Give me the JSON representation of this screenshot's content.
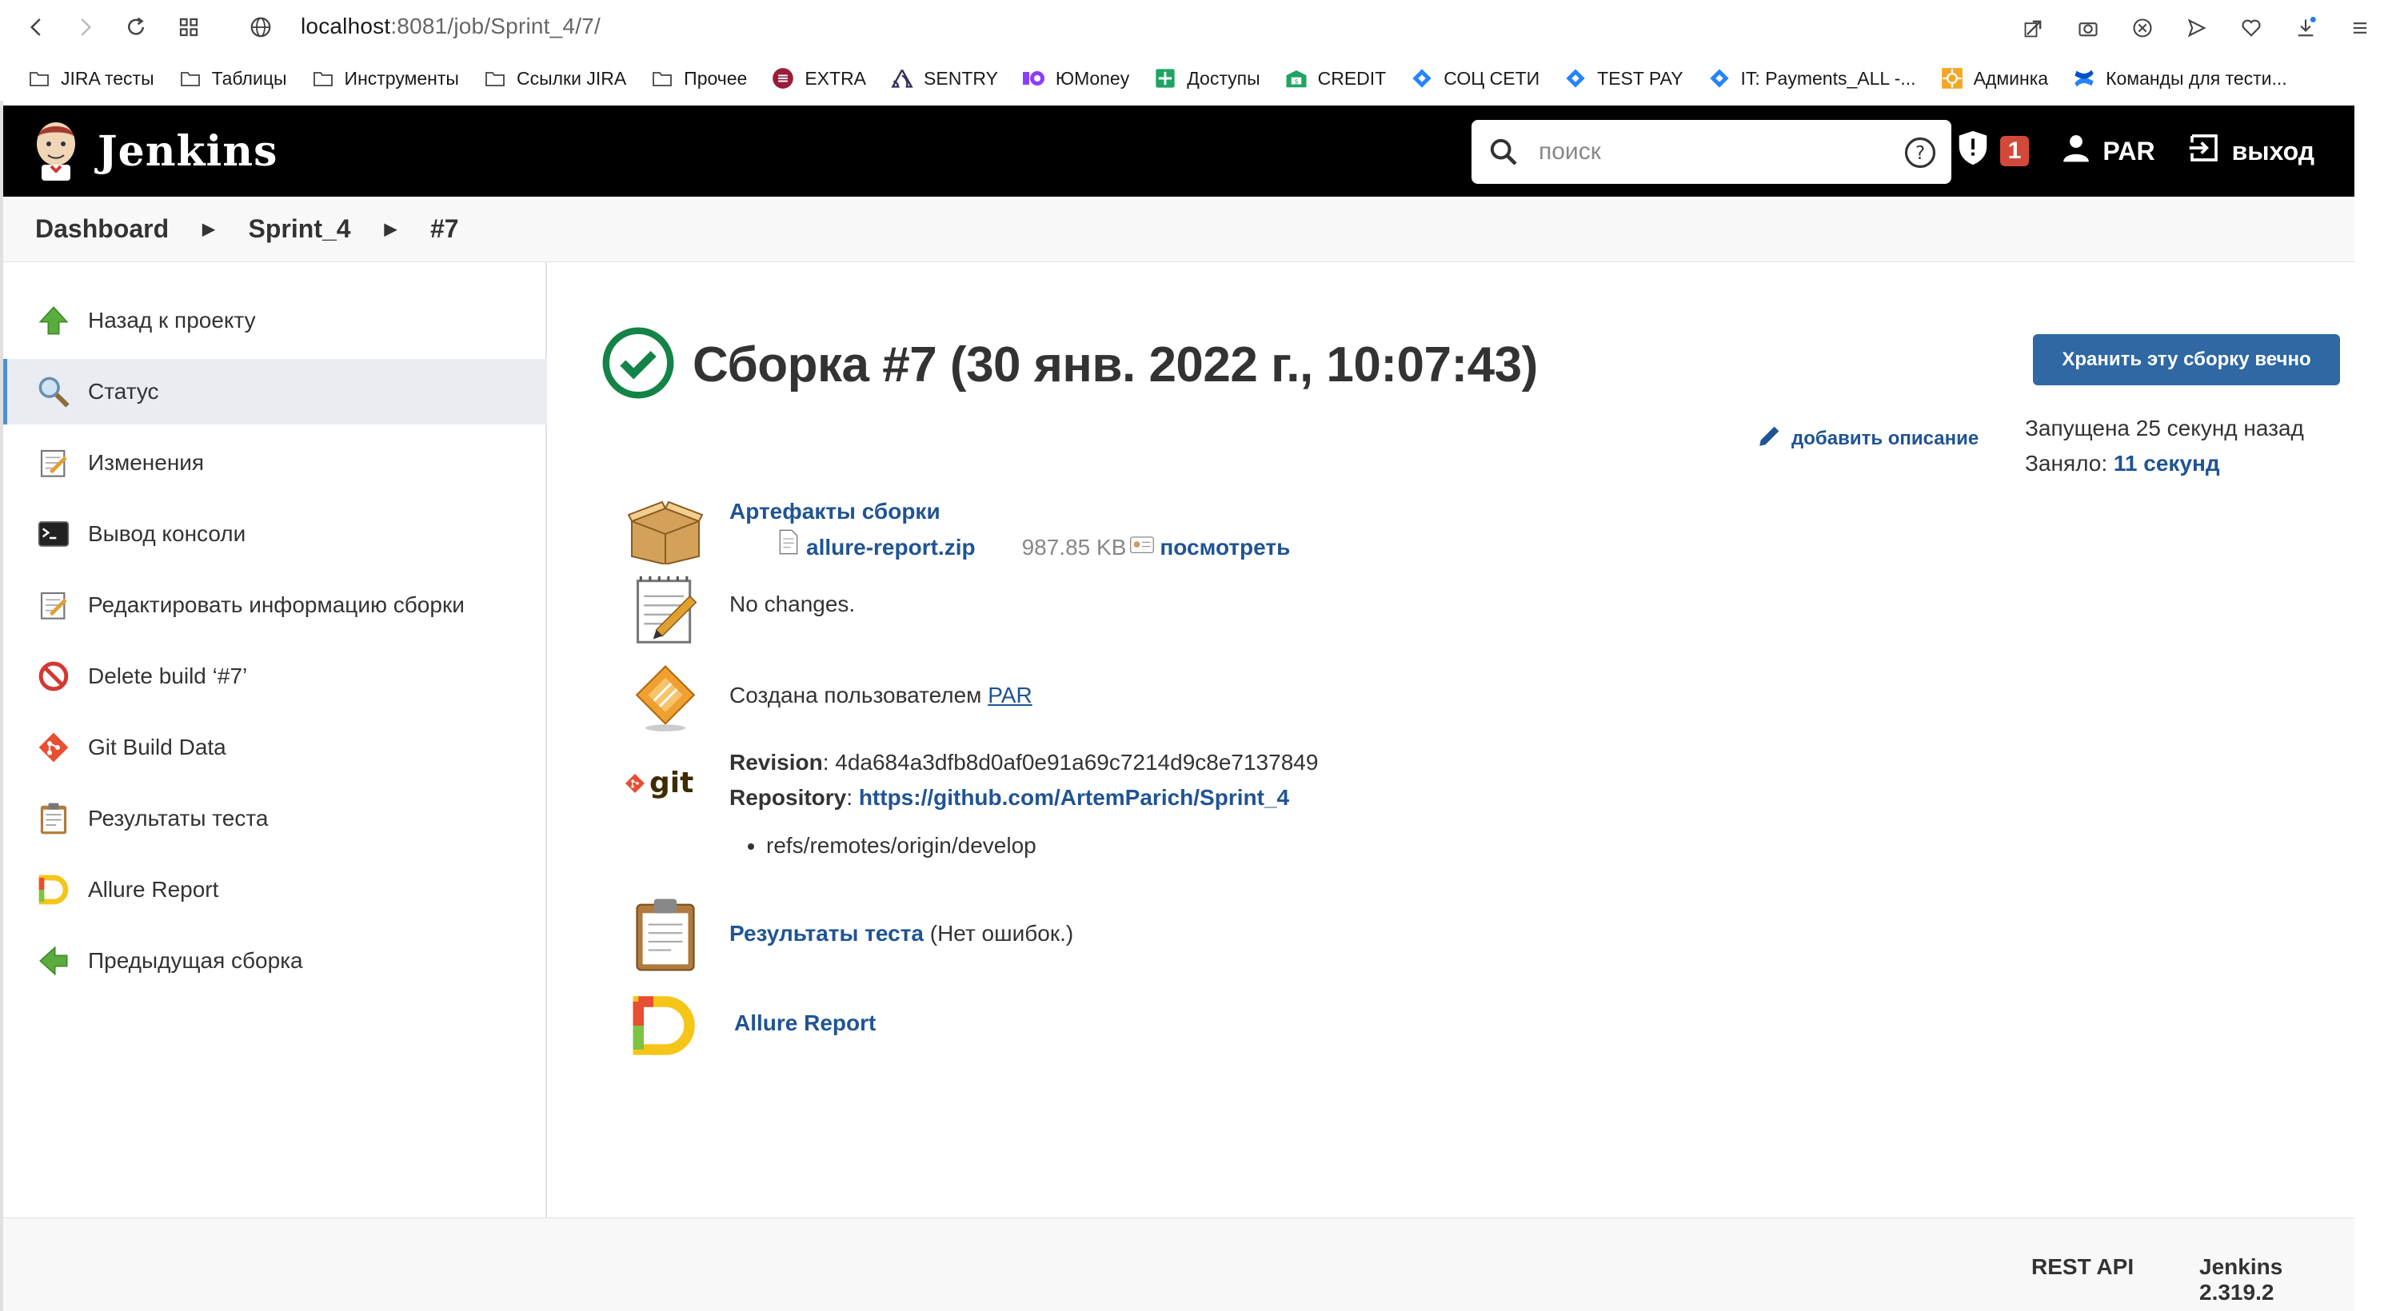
{
  "browser": {
    "url_host": "localhost",
    "url_rest": ":8081/job/Sprint_4/7/",
    "bookmarks": [
      {
        "label": "JIRA  тесты",
        "icon": "folder-icon"
      },
      {
        "label": "Таблицы",
        "icon": "folder-icon"
      },
      {
        "label": "Инструменты",
        "icon": "folder-icon"
      },
      {
        "label": "Ссылки JIRA",
        "icon": "folder-icon"
      },
      {
        "label": "Прочее",
        "icon": "folder-icon"
      },
      {
        "label": "EXTRA",
        "icon": "extra-icon"
      },
      {
        "label": "SENTRY",
        "icon": "sentry-icon"
      },
      {
        "label": "ЮMoney",
        "icon": "yumoney-icon"
      },
      {
        "label": "Доступы",
        "icon": "sheets-icon"
      },
      {
        "label": "CREDIT",
        "icon": "credit-icon"
      },
      {
        "label": "СОЦ СЕТИ",
        "icon": "jira-icon"
      },
      {
        "label": "TEST PAY",
        "icon": "jira-icon"
      },
      {
        "label": "IT: Payments_ALL -...",
        "icon": "jira-icon"
      },
      {
        "label": "Админка",
        "icon": "admin-icon"
      },
      {
        "label": "Команды для тести...",
        "icon": "confluence-icon"
      }
    ]
  },
  "header": {
    "brand": "Jenkins",
    "search_placeholder": "поиск",
    "alerts_count": "1",
    "user": "PAR",
    "logout": "выход"
  },
  "breadcrumb": {
    "items": [
      "Dashboard",
      "Sprint_4",
      "#7"
    ]
  },
  "sidebar": {
    "items": [
      {
        "label": "Назад к проекту"
      },
      {
        "label": "Статус"
      },
      {
        "label": "Изменения"
      },
      {
        "label": "Вывод консоли"
      },
      {
        "label": "Редактировать информацию сборки"
      },
      {
        "label": "Delete build ‘#7’"
      },
      {
        "label": "Git Build Data"
      },
      {
        "label": "Результаты теста"
      },
      {
        "label": "Allure Report"
      },
      {
        "label": "Предыдущая сборка"
      }
    ]
  },
  "main": {
    "title": "Сборка #7 (30 янв. 2022 г., 10:07:43)",
    "keep_button": "Хранить эту сборку вечно",
    "add_description": "добавить описание",
    "started": "Запущена 25 секунд назад",
    "took_label": "Заняло:",
    "took_value": "11 секунд",
    "artifacts_title": "Артефакты сборки",
    "artifact_file": "allure-report.zip",
    "artifact_size": "987.85 KB",
    "artifact_view": "посмотреть",
    "changes": "No changes.",
    "created_by_label": "Создана пользователем",
    "created_by_user": "PAR",
    "revision_label": "Revision",
    "revision_value": ": 4da684a3dfb8d0af0e91a69c7214d9c8e7137849",
    "repository_label": "Repository",
    "repository_colon": ": ",
    "repository_url": "https://github.com/ArtemParich/Sprint_4",
    "branch": "refs/remotes/origin/develop",
    "git_logo_text": "git",
    "test_results_link": "Результаты теста",
    "test_results_note": " (Нет ошибок.)",
    "allure_link": "Allure Report"
  },
  "footer": {
    "rest_api": "REST API",
    "version": "Jenkins 2.319.2"
  },
  "colors": {
    "header_bg": "#000000",
    "link": "#205493",
    "keep_button_bg": "#2f68a2",
    "badge": "#d24939",
    "success": "#138347"
  }
}
